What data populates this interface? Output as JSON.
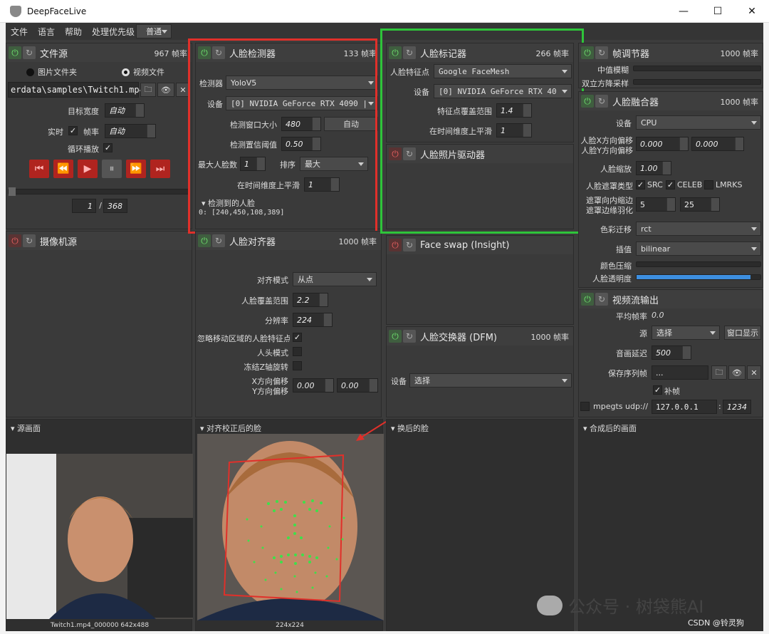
{
  "window": {
    "title": "DeepFaceLive",
    "min": "—",
    "max": "☐",
    "close": "✕"
  },
  "menu": {
    "file": "文件",
    "language": "语言",
    "help": "帮助",
    "priority_label": "处理优先级",
    "priority_value": "普通"
  },
  "file_source": {
    "title": "文件源",
    "fps": "967 帧率",
    "opt_images": "图片文件夹",
    "opt_video": "视频文件",
    "path": "erdata\\samples\\Twitch1.mp4",
    "target_width_label": "目标宽度",
    "target_width_value": "自动",
    "realtime_label": "实时",
    "fps_label": "帧率",
    "fps_value": "自动",
    "loop_label": "循环播放",
    "frame_current": "1",
    "frame_total": "368"
  },
  "face_detector": {
    "title": "人脸检测器",
    "fps": "133 帧率",
    "detector_label": "检测器",
    "detector_value": "YoloV5",
    "device_label": "设备",
    "device_value": "[0] NVIDIA GeForce RTX 4090 |",
    "window_label": "检测窗口大小",
    "window_value": "480",
    "auto_btn": "自动",
    "threshold_label": "检测置信阈值",
    "threshold_value": "0.50",
    "max_faces_label": "最大人脸数",
    "max_faces_value": "1",
    "sort_label": "排序",
    "sort_value": "最大",
    "smooth_label": "在时间维度上平滑",
    "smooth_value": "1",
    "detected_label": "检测到的人脸",
    "detected_value": "0: [240,450,108,389]"
  },
  "face_marker": {
    "title": "人脸标记器",
    "fps": "266 帧率",
    "marker_label": "人脸特征点",
    "marker_value": "Google FaceMesh",
    "device_label": "设备",
    "device_value": "[0] NVIDIA GeForce RTX 40",
    "coverage_label": "特征点覆盖范围",
    "coverage_value": "1.4",
    "smooth_label": "在时间维度上平滑",
    "smooth_value": "1"
  },
  "face_animator": {
    "title": "人脸照片驱动器"
  },
  "frame_adjuster": {
    "title": "帧调节器",
    "fps": "1000 帧率",
    "median_label": "中值模糊",
    "bicubic_label": "双立方降采样"
  },
  "face_merger": {
    "title": "人脸融合器",
    "fps": "1000 帧率",
    "device_label": "设备",
    "device_value": "CPU",
    "x_offset_label": "人脸X方向偏移",
    "y_offset_label": "人脸Y方向偏移",
    "x_offset_value": "0.000",
    "y_offset_value": "0.000",
    "scale_label": "人脸缩放",
    "scale_value": "1.00",
    "mask_type_label": "人脸遮罩类型",
    "mask_src": "SRC",
    "mask_celeb": "CELEB",
    "mask_lmrks": "LMRKS",
    "erode_label": "遮罩向内缩边",
    "blur_label": "遮罩边缘羽化",
    "erode_value": "5",
    "blur_value": "25",
    "color_transfer_label": "色彩迁移",
    "color_transfer_value": "rct",
    "interp_label": "插值",
    "interp_value": "bilinear",
    "color_compress_label": "颜色压缩",
    "opacity_label": "人脸透明度"
  },
  "camera_source": {
    "title": "摄像机源"
  },
  "face_aligner": {
    "title": "人脸对齐器",
    "fps": "1000 帧率",
    "mode_label": "对齐模式",
    "mode_value": "从点",
    "coverage_label": "人脸覆盖范围",
    "coverage_value": "2.2",
    "resolution_label": "分辨率",
    "resolution_value": "224",
    "exclude_label": "忽略移动区域的人脸特征点",
    "head_mode_label": "人头模式",
    "freeze_z_label": "冻结Z轴旋转",
    "x_offset_label": "X方向偏移",
    "y_offset_label": "Y方向偏移",
    "x_offset_value": "0.00",
    "y_offset_value": "0.00"
  },
  "face_swap_insight": {
    "title": "Face swap (Insight)"
  },
  "face_swapper_dfm": {
    "title": "人脸交换器 (DFM)",
    "fps": "1000 帧率",
    "device_label": "设备",
    "device_value": "选择"
  },
  "stream_output": {
    "title": "视频流输出",
    "avg_fps_label": "平均帧率",
    "avg_fps_value": "0.0",
    "source_label": "源",
    "source_value": "选择",
    "window_btn": "窗口显示",
    "delay_label": "音画延迟",
    "delay_value": "500",
    "save_seq_label": "保存序列帧",
    "save_seq_value": "...",
    "fill_label": "补帧",
    "mpegts_label": "mpegts udp://",
    "host_value": "127.0.0.1",
    "port_value": "1234"
  },
  "previews": {
    "source": "源画面",
    "source_caption": "Twitch1.mp4_000000 642x488",
    "aligned": "对齐校正后的脸",
    "aligned_caption": "224x224",
    "swapped": "换后的脸",
    "merged": "合成后的画面"
  },
  "watermark": {
    "main": "公众号 · 树袋熊AI",
    "csdn": "CSDN @铃灵狗"
  }
}
